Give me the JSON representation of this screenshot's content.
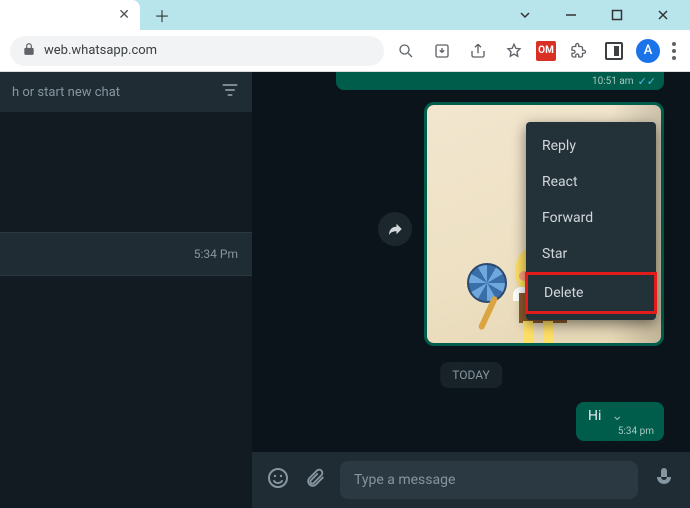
{
  "browser": {
    "url": "web.whatsapp.com",
    "avatar_letter": "A",
    "ext_badge": "OM"
  },
  "sidebar": {
    "search_placeholder": "h or start new chat",
    "chat_time": "5:34 Pm"
  },
  "chat": {
    "prev_time": "10:51 am",
    "today_label": "TODAY",
    "hi_text": "Hi",
    "hi_time": "5:34 pm"
  },
  "context_menu": {
    "reply": "Reply",
    "react": "React",
    "forward": "Forward",
    "star": "Star",
    "delete": "Delete"
  },
  "composer": {
    "placeholder": "Type a message"
  }
}
